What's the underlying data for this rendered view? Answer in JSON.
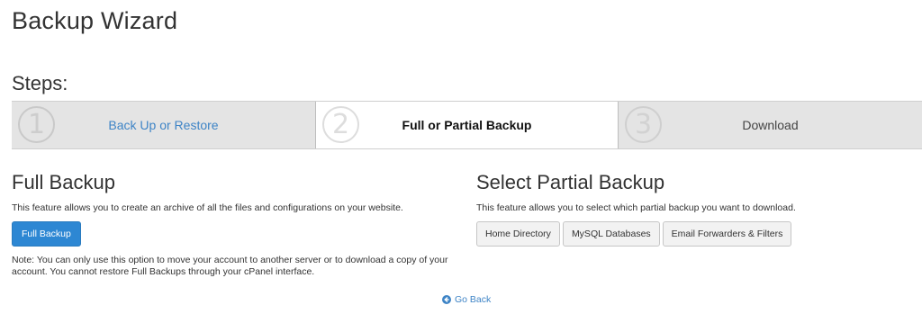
{
  "page": {
    "title": "Backup Wizard"
  },
  "steps": {
    "heading": "Steps:",
    "items": [
      {
        "number": "1",
        "label": "Back Up or Restore",
        "state": "link"
      },
      {
        "number": "2",
        "label": "Full or Partial Backup",
        "state": "active"
      },
      {
        "number": "3",
        "label": "Download",
        "state": "inactive"
      }
    ]
  },
  "full_backup": {
    "title": "Full Backup",
    "description": "This feature allows you to create an archive of all the files and configurations on your website.",
    "button_label": "Full Backup",
    "note": "Note: You can only use this option to move your account to another server or to download a copy of your account. You cannot restore Full Backups through your cPanel interface."
  },
  "partial_backup": {
    "title": "Select Partial Backup",
    "description": "This feature allows you to select which partial backup you want to download.",
    "buttons": [
      "Home Directory",
      "MySQL Databases",
      "Email Forwarders & Filters"
    ]
  },
  "footer": {
    "go_back_label": "Go Back",
    "go_back_icon": "arrow-circle-left-icon"
  },
  "colors": {
    "accent": "#2d87d3",
    "link": "#3e84c6",
    "steps_bg": "#e4e4e4"
  }
}
